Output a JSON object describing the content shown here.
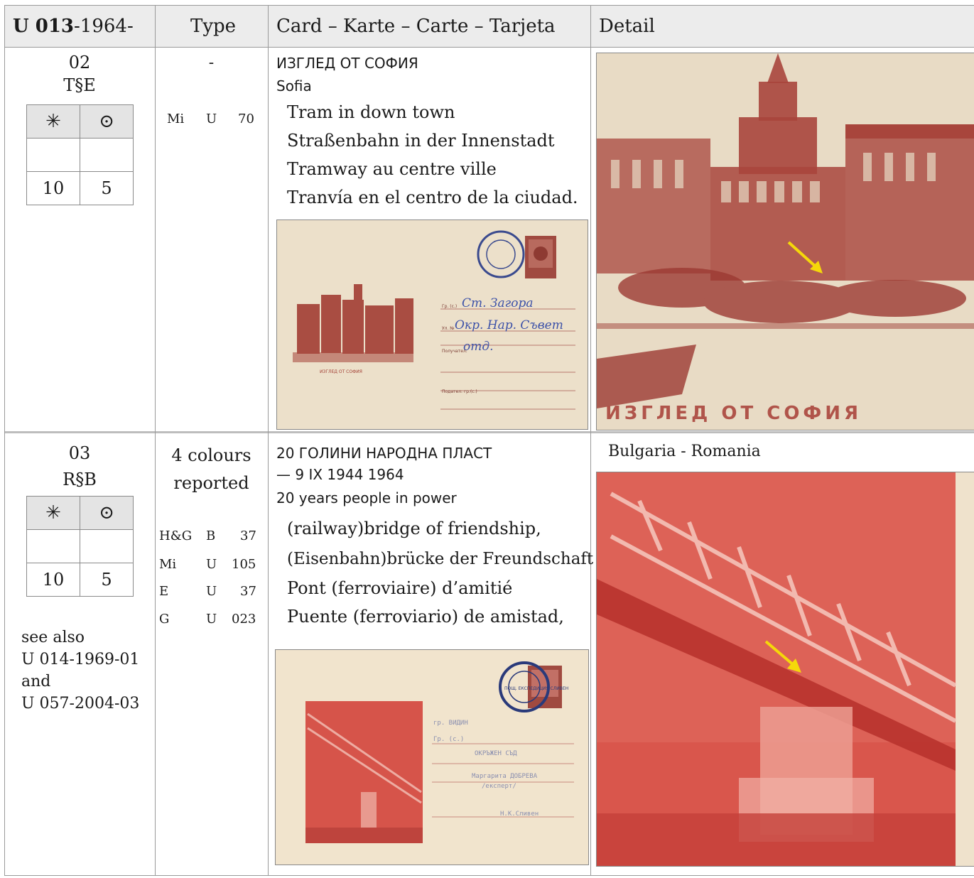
{
  "header": {
    "code_bold": "U 013",
    "code_rest": "-1964-",
    "type": "Type",
    "card": "Card – Karte – Carte – Tarjeta",
    "detail": "Detail"
  },
  "rows": [
    {
      "number": "02",
      "code": "T§E",
      "mint_symbol": "✳",
      "used_symbol": "⊙",
      "mint_value": "10",
      "used_value": "5",
      "type_text": "-",
      "refs": [
        {
          "cat": "Mi",
          "letter": "U",
          "num": "70"
        }
      ],
      "title_cyr": "ИЗГЛЕД ОТ СОФИЯ",
      "title_latin": "Sofia",
      "desc": [
        "Tram in down town",
        "Straßenbahn in der Innenstadt",
        "Tramway au centre ville",
        "Tranvía en el centro de la ciudad."
      ],
      "envelope": {
        "addr": [
          "Гр. (с.)",
          "Ул. №",
          "Получател:",
          "Подател: гр.(с.)"
        ],
        "handwriting": [
          "Ст. Загора",
          "Окр. Нар. Съвет",
          "отд."
        ],
        "caption": "ИЗГЛЕД ОТ СОФИЯ"
      },
      "detail_caption": "ИЗГЛЕД ОТ СОФИЯ"
    },
    {
      "number": "03",
      "code": "R§B",
      "mint_symbol": "✳",
      "used_symbol": "⊙",
      "mint_value": "10",
      "used_value": "5",
      "type_line1": "4 colours",
      "type_line2": "reported",
      "refs": [
        {
          "cat": "H&G",
          "letter": "B",
          "num": "37"
        },
        {
          "cat": "Mi",
          "letter": "U",
          "num": "105"
        },
        {
          "cat": "E",
          "letter": "U",
          "num": "37"
        },
        {
          "cat": "G",
          "letter": "U",
          "num": "023"
        }
      ],
      "see_also": [
        "see also",
        "U 014-1969-01",
        "and",
        "U 057-2004-03"
      ],
      "title_cyr_1": "20 ГОЛИНИ НАРОДНА ПЛАСТ",
      "title_cyr_2": "— 9 IX 1944 1964",
      "title_latin": "20 years people in power",
      "desc": [
        "(railway)bridge of friendship,",
        "(Eisenbahn)brücke der Freundschaft",
        "Pont (ferroviaire) d’amitié",
        "Puente (ferroviario) de amistad,"
      ],
      "envelope": {
        "postmark": "ПОЩ. ЕКСПЕДИЦИЯ СЛИВЕН",
        "lines": [
          "гр. ВИДИН",
          "Гр. (с.)",
          "ОКРЪЖЕН СЪД",
          "Маргарита ДОБРЕВА",
          "/експерт/",
          "Н.К.Сливен"
        ]
      },
      "detail_caption": "Bulgaria - Romania"
    }
  ],
  "colors": {
    "header_bg": "#ececec",
    "envelope_paper": "#eee2cc",
    "sepia_ink": "#9c3a32",
    "bridge_red": "#d6524a",
    "arrow": "#f5d80a"
  }
}
